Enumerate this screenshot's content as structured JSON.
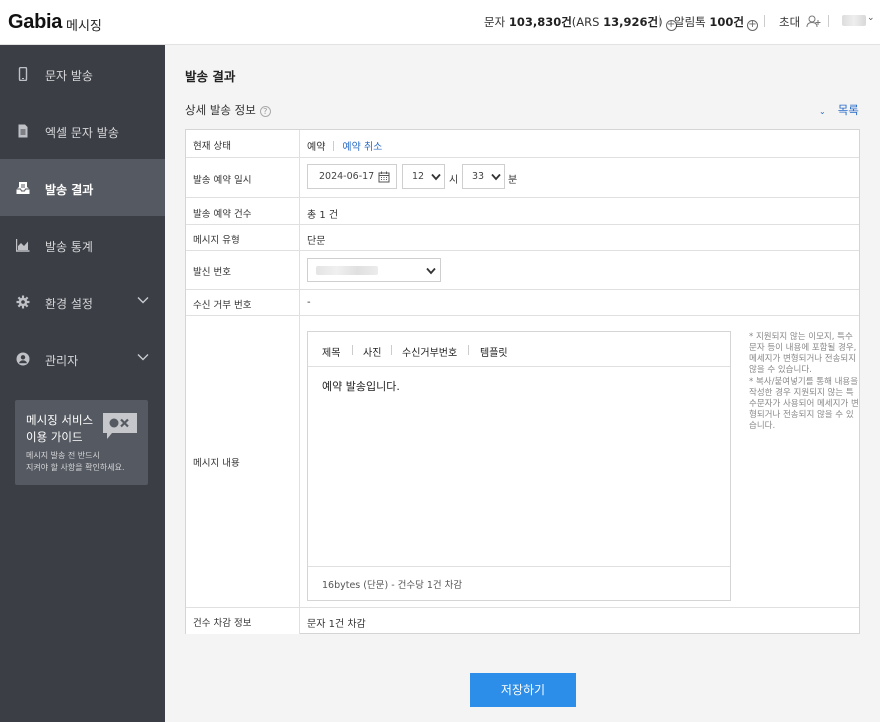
{
  "header": {
    "logo": "Gabia",
    "logo_sub": "메시징",
    "sms_label": "문자",
    "sms_count": "103,830건",
    "ars_label": "(ARS",
    "ars_count": "13,926건",
    "ars_close": ")",
    "alimtalk_label": "알림톡",
    "alimtalk_count": "100건",
    "invite_label": "초대"
  },
  "sidebar": {
    "items": [
      {
        "label": "문자 발송",
        "icon": "phone-icon"
      },
      {
        "label": "엑셀 문자 발송",
        "icon": "document-icon"
      },
      {
        "label": "발송 결과",
        "icon": "inbox-icon",
        "active": true
      },
      {
        "label": "발송 통계",
        "icon": "chart-icon"
      },
      {
        "label": "환경 설정",
        "icon": "gear-icon"
      },
      {
        "label": "관리자",
        "icon": "user-icon"
      }
    ],
    "guide": {
      "title_line1": "메시징 서비스",
      "title_line2": "이용 가이드",
      "desc_line1": "메시지 발송 전 반드시",
      "desc_line2": "지켜야 할 사항을 확인하세요."
    }
  },
  "main": {
    "page_title": "발송 결과",
    "section_title": "상세 발송 정보",
    "list_link": "목록",
    "rows": {
      "status": {
        "label": "현재 상태",
        "value": "예약",
        "cancel_link": "예약 취소"
      },
      "schedule": {
        "label": "발송 예약 일시",
        "date": "2024-06-17",
        "hour": "12",
        "hour_unit": "시",
        "minute": "33",
        "minute_unit": "분"
      },
      "count": {
        "label": "발송 예약 건수",
        "value": "총 1 건"
      },
      "type": {
        "label": "메시지 유형",
        "value": "단문"
      },
      "sender": {
        "label": "발신 번호"
      },
      "reject": {
        "label": "수신 거부 번호",
        "value": "-"
      },
      "content": {
        "label": "메시지 내용",
        "tabs": [
          "제목",
          "사진",
          "수신거부번호",
          "템플릿"
        ],
        "text": "예약 발송입니다.",
        "footer": "16bytes (단문) - 건수당 1건 차감",
        "note1": "*  지원되지 않는 이모지, 특수문자 등이 내용에 포함될 경우, 메세지가 변형되거나 전송되지 않을 수 있습니다.",
        "note2": "*  복사/붙여넣기를 통해 내용을 작성한 경우 지원되지 않는 특수문자가 사용되어 메세지가 변형되거나 전송되지 않을 수 있습니다."
      },
      "deduct": {
        "label": "건수 차감 정보",
        "value": "문자 1건 차감"
      }
    },
    "save_button": "저장하기"
  },
  "colors": {
    "accent": "#2c8ee8",
    "link": "#2a6cc7",
    "sidebar": "#3b3e45",
    "sidebar_active": "#555961"
  }
}
